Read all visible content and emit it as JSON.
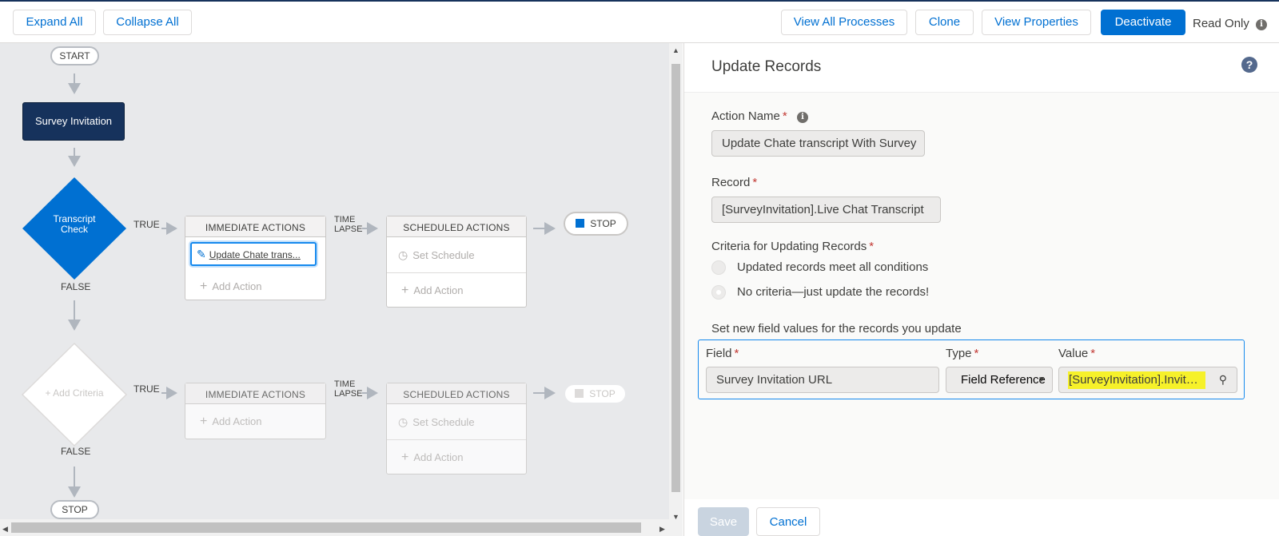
{
  "toolbar": {
    "expand_all": "Expand All",
    "collapse_all": "Collapse All",
    "view_all_processes": "View All Processes",
    "clone": "Clone",
    "view_properties": "View Properties",
    "deactivate": "Deactivate",
    "read_only": "Read Only",
    "info_icon": "info-icon"
  },
  "canvas": {
    "start": "START",
    "object_node": "Survey Invitation",
    "criteria1": {
      "line1": "Transcript",
      "line2": "Check"
    },
    "criteria2": "Add Criteria",
    "true_label": "TRUE",
    "false_label": "FALSE",
    "time_lapse": {
      "line1": "TIME",
      "line2": "LAPSE"
    },
    "immediate_actions": "IMMEDIATE ACTIONS",
    "scheduled_actions": "SCHEDULED ACTIONS",
    "action_item": "Update Chate trans...",
    "add_action": "Add Action",
    "set_schedule": "Set Schedule",
    "stop": "STOP",
    "end_stop": "STOP"
  },
  "panel": {
    "title": "Update Records",
    "action_name_label": "Action Name",
    "action_name_value": "Update Chate transcript With Survey",
    "record_label": "Record",
    "record_value": "[SurveyInvitation].Live Chat Transcript",
    "criteria_label": "Criteria for Updating Records",
    "criteria_options": [
      "Updated records meet all conditions",
      "No criteria—just update the records!"
    ],
    "selected_criteria": "No criteria—just update the records!",
    "set_values_label": "Set new field values for the records you update",
    "columns": {
      "field": "Field",
      "type": "Type",
      "value": "Value"
    },
    "row": {
      "field": "Survey Invitation URL",
      "type": "Field Reference",
      "value": "[SurveyInvitation].Invitati..."
    },
    "save": "Save",
    "cancel": "Cancel",
    "required_mark": "*"
  },
  "colors": {
    "brand": "#0070d2",
    "navy": "#16325c",
    "highlight": "#f6f12a"
  }
}
